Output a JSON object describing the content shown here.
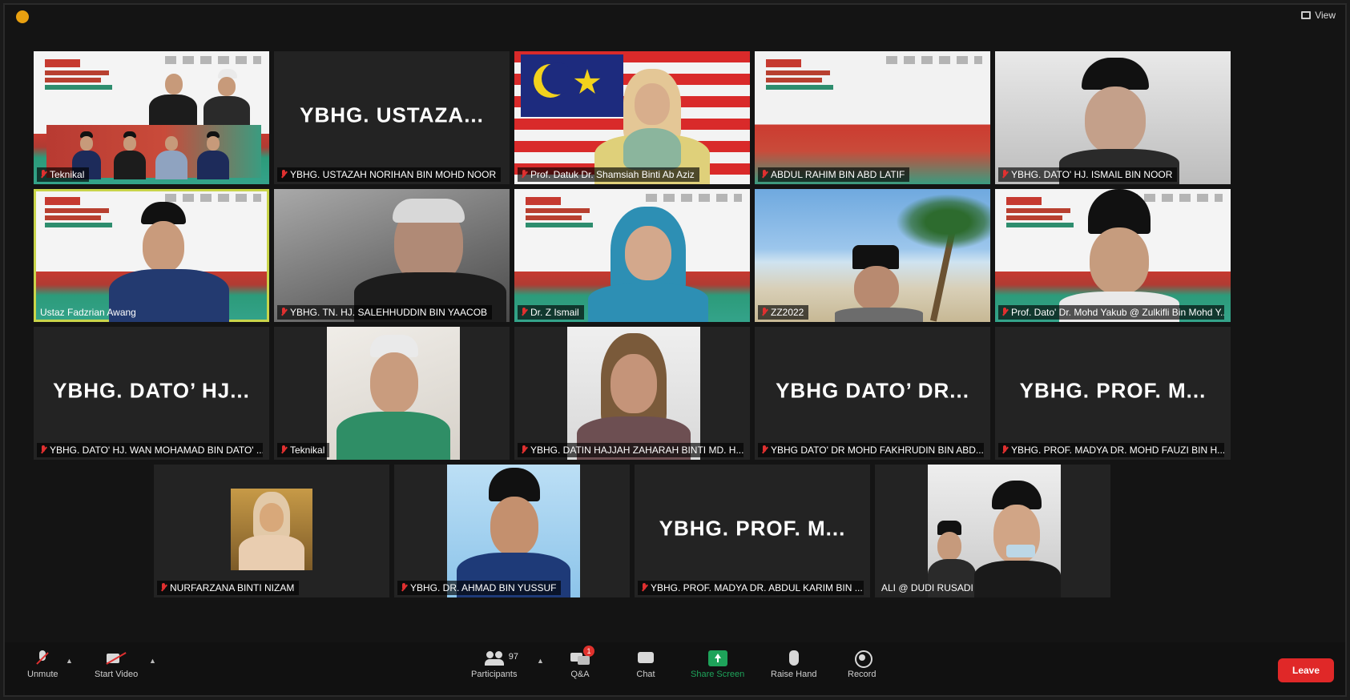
{
  "topbar": {
    "view_label": "View"
  },
  "tiles": [
    {
      "name": "Teknikal"
    },
    {
      "name": "YBHG. USTAZAH NORIHAN BIN MOHD NOOR",
      "display": "YBHG.  USTAZA..."
    },
    {
      "name": "Prof. Datuk Dr. Shamsiah Binti Ab Aziz"
    },
    {
      "name": "ABDUL RAHIM BIN ABD LATIF"
    },
    {
      "name": "YBHG. DATO' HJ. ISMAIL BIN NOOR"
    },
    {
      "name": "Ustaz Fadzrian Awang"
    },
    {
      "name": "YBHG. TN. HJ. SALEHHUDDIN BIN YAACOB"
    },
    {
      "name": "Dr. Z Ismail"
    },
    {
      "name": "ZZ2022"
    },
    {
      "name": "Prof. Dato' Dr. Mohd Yakub @ Zulkifli Bin Mohd Y..."
    },
    {
      "name": "YBHG. DATO' HJ. WAN MOHAMAD BIN DATO' ...",
      "display": "YBHG.  DATO’ HJ..."
    },
    {
      "name": "Teknikal"
    },
    {
      "name": "YBHG. DATIN HAJJAH ZAHARAH BINTI MD. H..."
    },
    {
      "name": "YBHG DATO' DR MOHD FAKHRUDIN BIN ABD...",
      "display": "YBHG  DATO’ DR..."
    },
    {
      "name": "YBHG. PROF. MADYA DR. MOHD FAUZI BIN H...",
      "display": "YBHG.  PROF.  M..."
    },
    {
      "name": "NURFARZANA BINTI NIZAM"
    },
    {
      "name": "YBHG. DR. AHMAD BIN YUSSUF"
    },
    {
      "name": "YBHG. PROF. MADYA DR. ABDUL KARIM BIN ...",
      "display": "YBHG.  PROF.  M..."
    },
    {
      "name": "ALI @ DUDI RUSADI"
    }
  ],
  "toolbar": {
    "unmute": "Unmute",
    "start_video": "Start Video",
    "participants": "Participants",
    "participants_count": "97",
    "qa": "Q&A",
    "qa_badge": "1",
    "chat": "Chat",
    "share_screen": "Share Screen",
    "raise_hand": "Raise Hand",
    "record": "Record",
    "leave": "Leave"
  },
  "colors": {
    "active_speaker": "#c9d44a",
    "leave": "#e02828",
    "share": "#1ea35a",
    "muted": "#e03030"
  }
}
